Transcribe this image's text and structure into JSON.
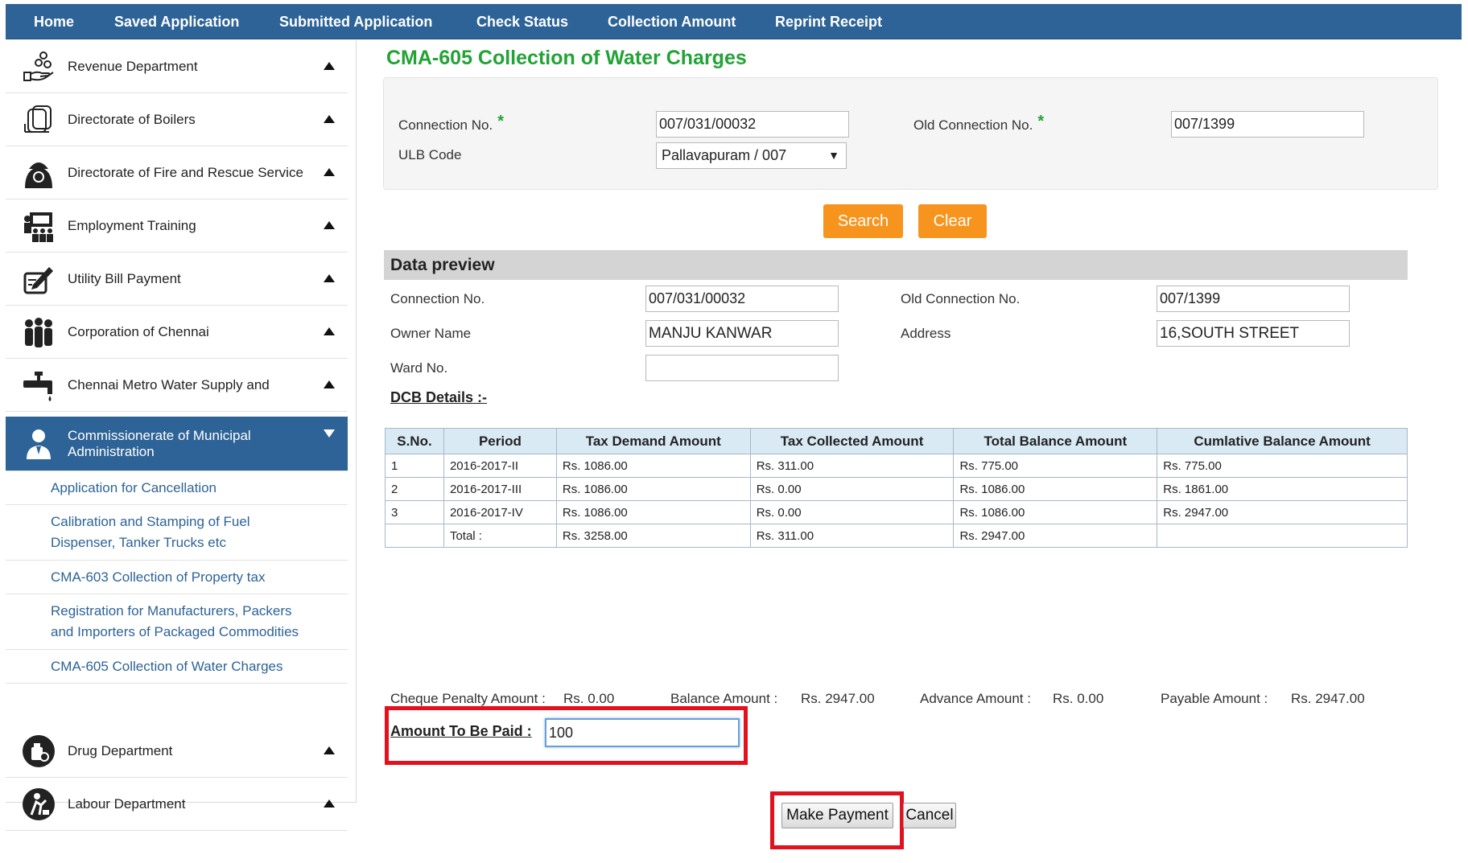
{
  "nav": {
    "items": [
      "Home",
      "Saved Application",
      "Submitted Application",
      "Check Status",
      "Collection Amount",
      "Reprint Receipt"
    ]
  },
  "sidebar": {
    "departments": [
      {
        "label": "Revenue Department",
        "icon": "hand-coins-icon"
      },
      {
        "label": "Directorate of Boilers",
        "icon": "boiler-icon"
      },
      {
        "label": "Directorate of Fire and Rescue Service",
        "icon": "firefighter-icon"
      },
      {
        "label": "Employment Training",
        "icon": "training-icon"
      },
      {
        "label": "Utility Bill Payment",
        "icon": "bill-pen-icon"
      },
      {
        "label": "Corporation of Chennai",
        "icon": "people-group-icon"
      },
      {
        "label": "Chennai Metro Water Supply and",
        "icon": "water-tap-icon"
      }
    ],
    "active": {
      "label": "Commissionerate of Municipal Administration",
      "icon": "officer-icon"
    },
    "submenu": [
      "Application for Cancellation",
      "Calibration and Stamping of Fuel Dispenser, Tanker Trucks etc",
      "CMA-603 Collection of Property tax",
      "Registration for Manufacturers, Packers and Importers of Packaged Commodities",
      "CMA-605 Collection of Water Charges"
    ],
    "bottom": [
      {
        "label": "Drug Department",
        "icon": "drug-icon"
      },
      {
        "label": "Labour Department",
        "icon": "worker-icon"
      }
    ]
  },
  "page": {
    "title": "CMA-605 Collection of Water Charges"
  },
  "search": {
    "connection_label": "Connection No.",
    "connection_value": "007/031/00032",
    "old_connection_label": "Old Connection No.",
    "old_connection_value": "007/1399",
    "ulb_label": "ULB Code",
    "ulb_value": "Pallavapuram / 007",
    "required_mark": "*",
    "search_button": "Search",
    "clear_button": "Clear"
  },
  "preview": {
    "title": "Data preview",
    "connection_label": "Connection No.",
    "connection_value": "007/031/00032",
    "old_connection_label": "Old Connection No.",
    "old_connection_value": "007/1399",
    "owner_label": "Owner Name",
    "owner_value": "MANJU KANWAR",
    "address_label": "Address",
    "address_value": "16,SOUTH STREET",
    "ward_label": "Ward No.",
    "ward_value": ""
  },
  "dcb": {
    "title": "DCB Details :-",
    "headers": [
      "S.No.",
      "Period",
      "Tax Demand Amount",
      "Tax Collected Amount",
      "Total Balance Amount",
      "Cumlative Balance Amount"
    ],
    "rows": [
      [
        "1",
        "2016-2017-II",
        "Rs. 1086.00",
        "Rs. 311.00",
        "Rs. 775.00",
        "Rs. 775.00"
      ],
      [
        "2",
        "2016-2017-III",
        "Rs. 1086.00",
        "Rs. 0.00",
        "Rs. 1086.00",
        "Rs. 1861.00"
      ],
      [
        "3",
        "2016-2017-IV",
        "Rs. 1086.00",
        "Rs. 0.00",
        "Rs. 1086.00",
        "Rs. 2947.00"
      ],
      [
        "",
        "Total :",
        "Rs. 3258.00",
        "Rs. 311.00",
        "Rs. 2947.00",
        ""
      ]
    ]
  },
  "summary": {
    "cheque_penalty_label": "Cheque Penalty Amount :",
    "cheque_penalty_value": "Rs. 0.00",
    "balance_label": "Balance Amount :",
    "balance_value": "Rs. 2947.00",
    "advance_label": "Advance Amount :",
    "advance_value": "Rs. 0.00",
    "payable_label": "Payable Amount :",
    "payable_value": "Rs. 2947.00"
  },
  "payment": {
    "amount_label": "Amount To Be Paid :",
    "amount_value": "100",
    "make_payment_button": "Make Payment",
    "cancel_button": "Cancel"
  },
  "colors": {
    "nav_bg": "#2d6396",
    "title_green": "#22a336",
    "accent_orange": "#f7941d",
    "highlight_red": "#e3101e"
  }
}
